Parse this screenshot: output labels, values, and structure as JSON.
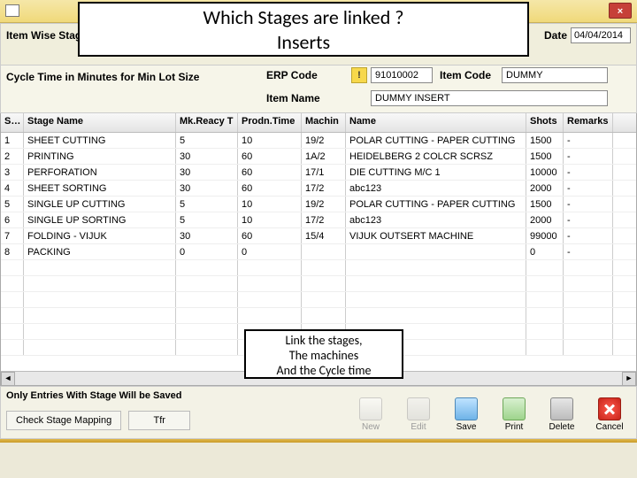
{
  "window": {
    "title": "Item Wise Stage"
  },
  "overlay": {
    "heading_line1": "Which Stages are linked ?",
    "heading_line2": "Inserts",
    "note_line1": "Link the stages,",
    "note_line2": "The machines",
    "note_line3": "And the Cycle time"
  },
  "header": {
    "stage_label": "Item Wise Stag",
    "date_label": "Date",
    "date_value": "04/04/2014"
  },
  "filters": {
    "cycle_label": "Cycle Time in Minutes for Min Lot Size",
    "erp_label": "ERP Code",
    "erp_value": "91010002",
    "item_label": "Item Code",
    "item_value": "DUMMY",
    "itemname_label": "Item Name",
    "itemname_value": "DUMMY INSERT",
    "warn_glyph": "!"
  },
  "grid": {
    "headers": {
      "sr": "Srn",
      "stage": "Stage Name",
      "mk": "Mk.Reacy T",
      "prod": "Prodn.Time",
      "mach": "Machin",
      "name": "Name",
      "shots": "Shots",
      "rem": "Remarks"
    },
    "rows": [
      {
        "sr": "1",
        "stage": "SHEET CUTTING",
        "mk": "5",
        "prod": "10",
        "mach": "19/2",
        "name": "POLAR CUTTING - PAPER CUTTING",
        "shots": "1500",
        "rem": "-"
      },
      {
        "sr": "2",
        "stage": "PRINTING",
        "mk": "30",
        "prod": "60",
        "mach": "1A/2",
        "name": "HEIDELBERG 2 COLCR SCRSZ",
        "shots": "1500",
        "rem": "-"
      },
      {
        "sr": "3",
        "stage": "PERFORATION",
        "mk": "30",
        "prod": "60",
        "mach": "17/1",
        "name": "DIE CUTTING M/C 1",
        "shots": "10000",
        "rem": "-"
      },
      {
        "sr": "4",
        "stage": "SHEET SORTING",
        "mk": "30",
        "prod": "60",
        "mach": "17/2",
        "name": "abc123",
        "shots": "2000",
        "rem": "-"
      },
      {
        "sr": "5",
        "stage": "SINGLE UP CUTTING",
        "mk": "5",
        "prod": "10",
        "mach": "19/2",
        "name": "POLAR CUTTING - PAPER CUTTING",
        "shots": "1500",
        "rem": "-"
      },
      {
        "sr": "6",
        "stage": "SINGLE UP SORTING",
        "mk": "5",
        "prod": "10",
        "mach": "17/2",
        "name": "abc123",
        "shots": "2000",
        "rem": "-"
      },
      {
        "sr": "7",
        "stage": "FOLDING - VIJUK",
        "mk": "30",
        "prod": "60",
        "mach": "15/4",
        "name": "VIJUK OUTSERT MACHINE",
        "shots": "99000",
        "rem": "-"
      },
      {
        "sr": "8",
        "stage": "PACKING",
        "mk": "0",
        "prod": "0",
        "mach": "",
        "name": "",
        "shots": "0",
        "rem": "-"
      }
    ]
  },
  "toolbar": {
    "savenote": "Only Entries With Stage Will be Saved",
    "check_label": "Check Stage Mapping",
    "tfr_label": "Tfr",
    "new": "New",
    "edit": "Edit",
    "save": "Save",
    "print": "Print",
    "delete": "Delete",
    "cancel": "Cancel"
  }
}
